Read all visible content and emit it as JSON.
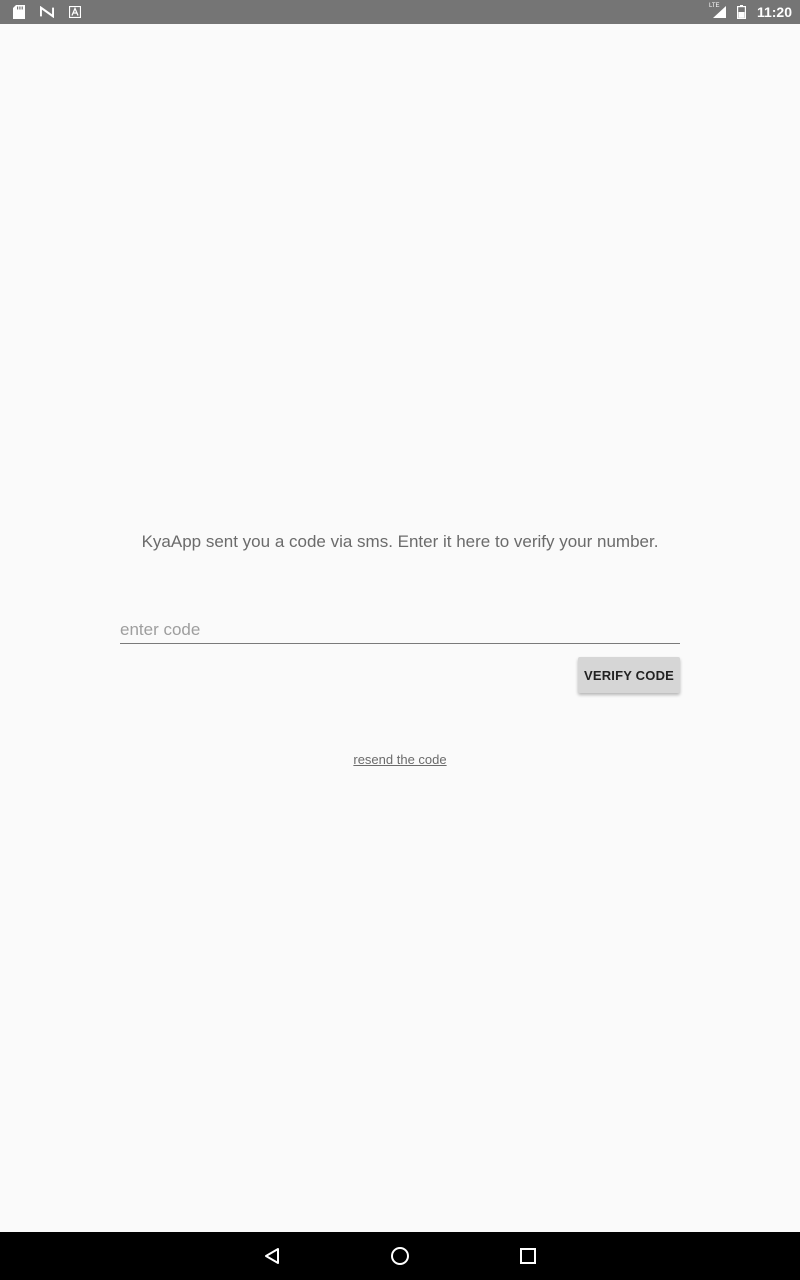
{
  "status_bar": {
    "left_icons": [
      "sd-card-icon",
      "n-notification-icon",
      "a-notification-icon"
    ],
    "network_label": "LTE",
    "time": "11:20"
  },
  "verification": {
    "message": "KyaApp sent you a code via sms. Enter it here to verify your number.",
    "code_input": {
      "placeholder": "enter code",
      "value": ""
    },
    "verify_button_label": "VERIFY CODE",
    "resend_link_label": "resend the code"
  },
  "nav_bar": {
    "buttons": [
      "back-icon",
      "home-icon",
      "recents-icon"
    ]
  }
}
